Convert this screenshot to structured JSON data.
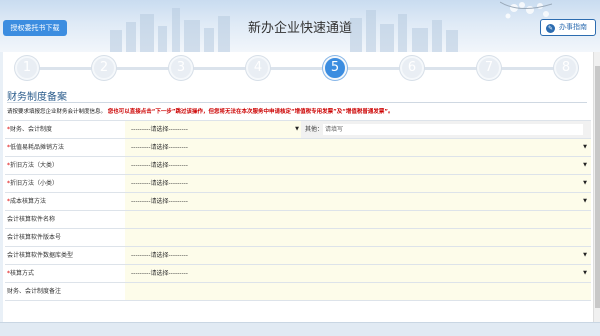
{
  "header": {
    "title": "新办企业快速通道",
    "auth_download_label": "授权委托书下载",
    "guide_label": "办事指南",
    "guide_icon": "compass-icon"
  },
  "steps": {
    "items": [
      "1",
      "2",
      "3",
      "4",
      "5",
      "6",
      "7",
      "8"
    ],
    "current": "5",
    "active_color": "#3c8de0",
    "inactive_color": "#e9eef4"
  },
  "section": {
    "title": "财务制度备案",
    "notice_prefix": "请按要求填报您企业财务会计制度信息。",
    "notice_highlight": "您也可以直接点击“下一步”跳过该操作，但您将无法在本次服务中申请核定“增值税专用发票”及“增值税普通发票”。"
  },
  "form": {
    "select_placeholder": "---------请选择---------",
    "other_label": "其他：",
    "other_placeholder": "请填写",
    "rows": [
      {
        "label": "财务、会计制度",
        "required": "*"
      },
      {
        "label": "低值易耗品摊销方法",
        "required": "*"
      },
      {
        "label": "折旧方法（大类）",
        "required": "*"
      },
      {
        "label": "折旧方法（小类）",
        "required": "*"
      },
      {
        "label": "成本核算方法",
        "required": "*"
      },
      {
        "label": "会计核算软件名称",
        "required": ""
      },
      {
        "label": "会计核算软件版本号",
        "required": ""
      },
      {
        "label": "会计核算软件数据库类型",
        "required": ""
      },
      {
        "label": "核算方式",
        "required": "*"
      },
      {
        "label": "财务、会计制度备注",
        "required": ""
      }
    ]
  },
  "colors": {
    "accent": "#3c8de0",
    "required": "#dd0000",
    "field_bg": "#fdfcea"
  }
}
